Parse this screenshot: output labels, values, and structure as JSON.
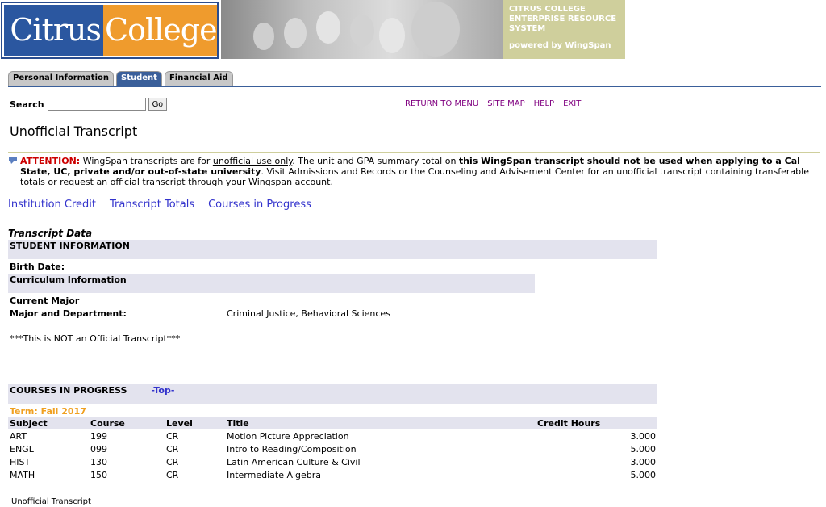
{
  "header": {
    "logo_left": "Citrus",
    "logo_right": "College",
    "erp_line1": "CITRUS COLLEGE",
    "erp_line2": "ENTERPRISE RESOURCE",
    "erp_line3": "SYSTEM",
    "powered_by": "powered by WingSpan"
  },
  "tabs": [
    {
      "label": "Personal Information",
      "active": false
    },
    {
      "label": "Student",
      "active": true
    },
    {
      "label": "Financial Aid",
      "active": false
    }
  ],
  "search": {
    "label": "Search",
    "value": "",
    "button": "Go"
  },
  "toplinks": {
    "return": "RETURN TO MENU",
    "sitemap": "SITE MAP",
    "help": "HELP",
    "exit": "EXIT"
  },
  "page_title": "Unofficial Transcript",
  "attention": {
    "label": "ATTENTION:",
    "part1": " WingSpan transcripts are for ",
    "underlined": "unofficial use only",
    "part2": ". The unit and GPA summary total on ",
    "bold": "this WingSpan transcript should not be used when applying to a Cal State, UC, private and/or out-of-state university",
    "part3": ". Visit Admissions and Records or the Counseling and Advisement Center for an unofficial transcript containing transferable totals or request an official transcript through your Wingspan account."
  },
  "sublinks": {
    "institution_credit": "Institution Credit",
    "transcript_totals": "Transcript Totals",
    "courses_in_progress": "Courses in Progress"
  },
  "transcript": {
    "heading": "Transcript Data",
    "student_info": "STUDENT INFORMATION",
    "birth_date_label": "Birth Date:",
    "curriculum_info": "Curriculum Information",
    "current_major": "Current Major",
    "major_dept_label": "Major and Department:",
    "major_dept_value": "Criminal Justice, Behavioral Sciences",
    "not_official": "***This is NOT an Official Transcript***"
  },
  "courses": {
    "heading": "COURSES IN PROGRESS",
    "top_link": "-Top-",
    "term": "Term: Fall 2017",
    "columns": [
      "Subject",
      "Course",
      "Level",
      "Title",
      "Credit Hours"
    ],
    "rows": [
      [
        "ART",
        "199",
        "CR",
        "Motion Picture Appreciation",
        "3.000"
      ],
      [
        "ENGL",
        "099",
        "CR",
        "Intro to Reading/Composition",
        "5.000"
      ],
      [
        "HIST",
        "130",
        "CR",
        "Latin American Culture & Civil",
        "3.000"
      ],
      [
        "MATH",
        "150",
        "CR",
        "Intermediate Algebra",
        "5.000"
      ]
    ]
  },
  "footer": "Unofficial Transcript",
  "colors": {
    "accent_blue": "#3a5f9a",
    "link_blue": "#3333cc",
    "link_purple": "#800080",
    "attention_red": "#cc0000",
    "term_orange": "#f0a020",
    "band_gray": "#e3e3ee",
    "olive": "#cfcf9c"
  }
}
